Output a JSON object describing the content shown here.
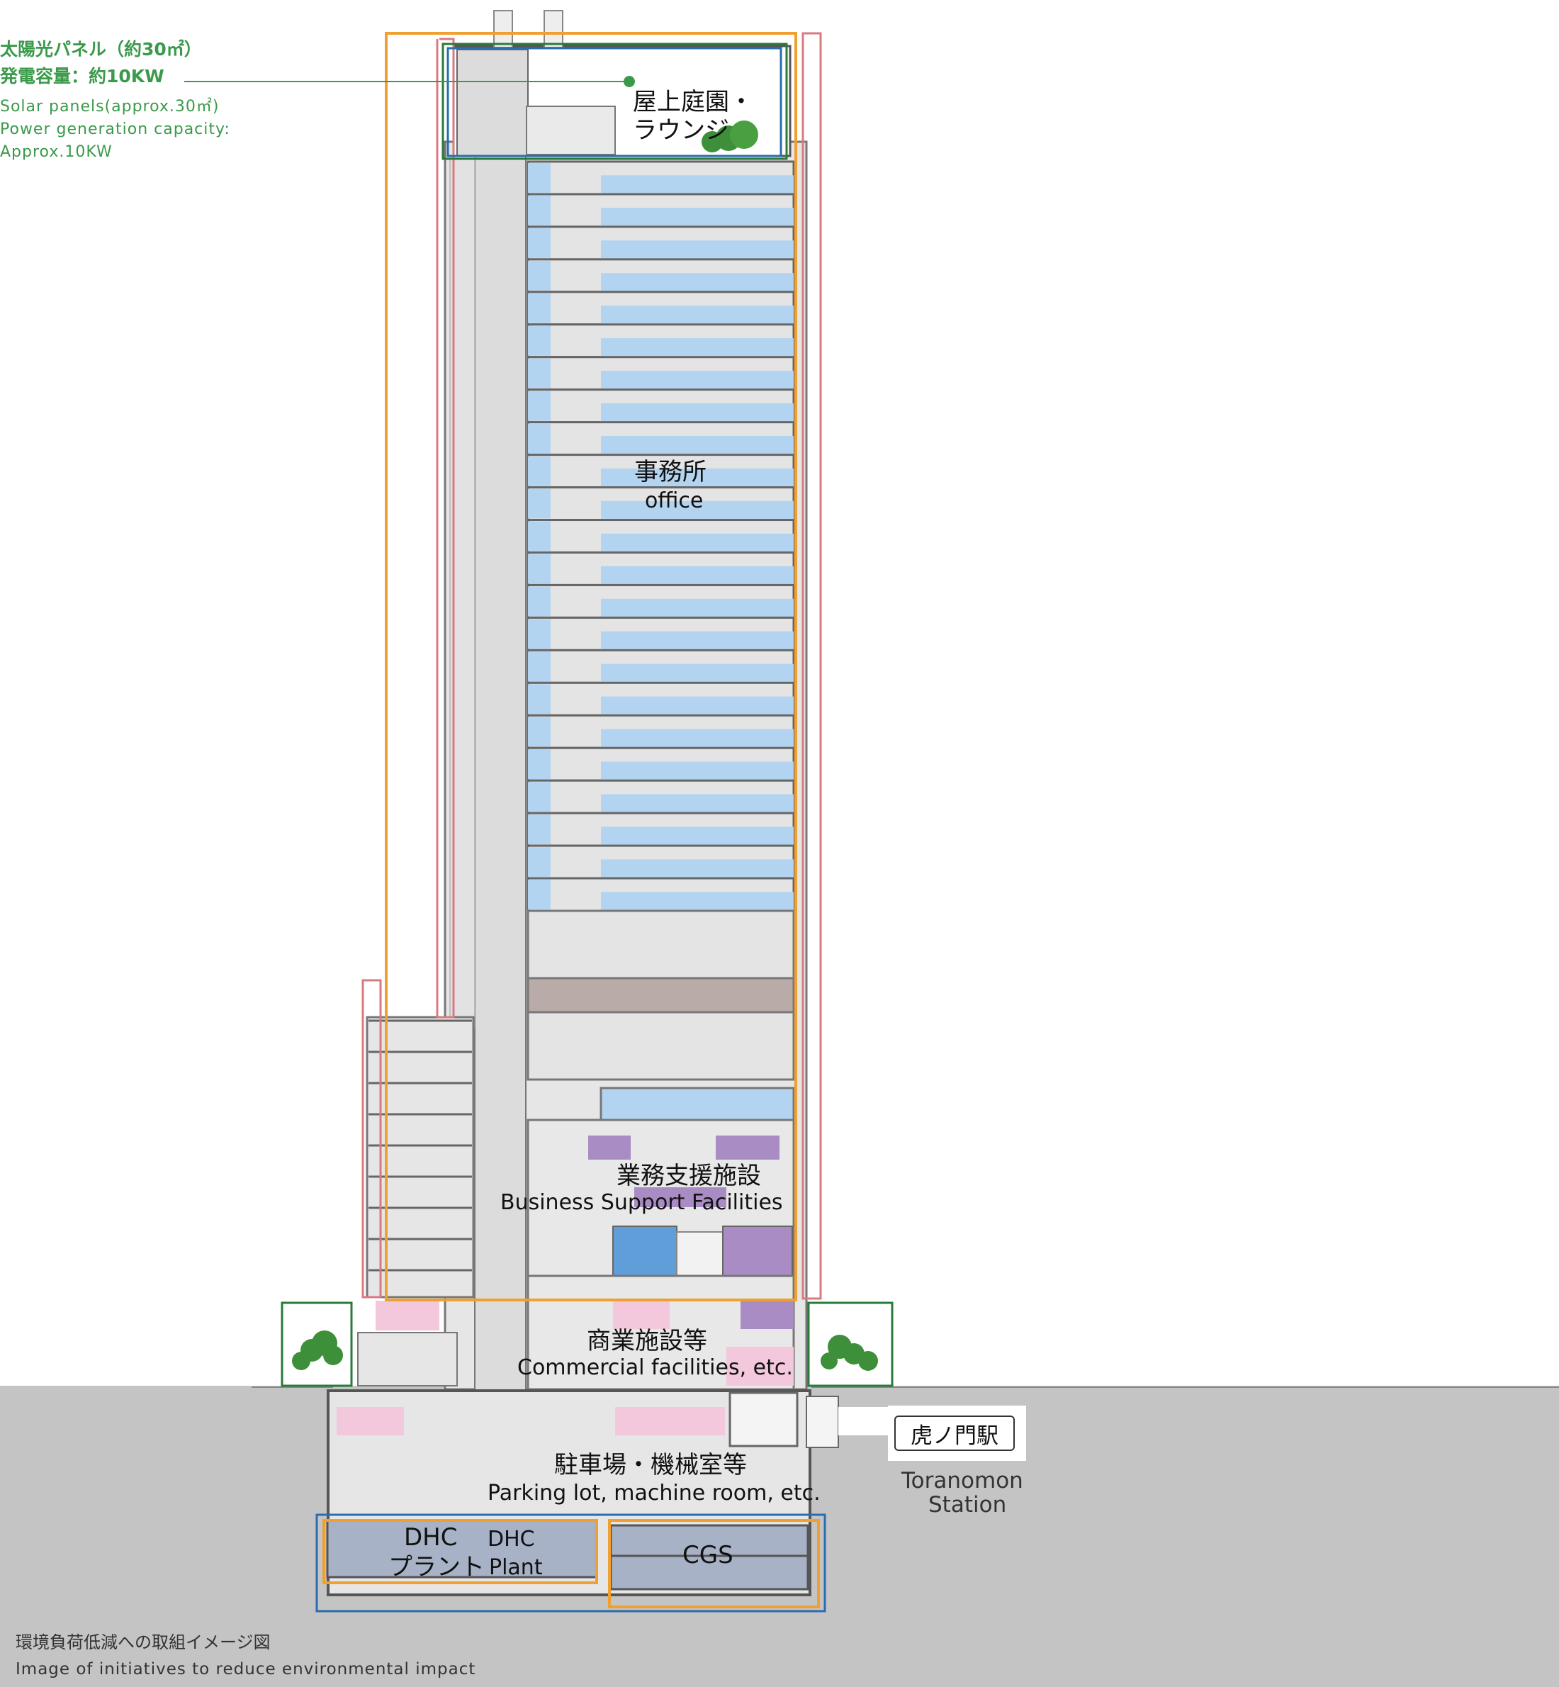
{
  "solar": {
    "ja_line1": "太陽光パネル（約30㎡）",
    "ja_line2": "発電容量：約10KW",
    "en_line1": "Solar panels(approx.30㎡)",
    "en_line2": "Power generation capacity:",
    "en_line3": "Approx.10KW"
  },
  "rooftop": {
    "ja_line1": "屋上庭園・",
    "ja_line2": "ラウンジ"
  },
  "office": {
    "ja": "事務所",
    "en": "office"
  },
  "business_support": {
    "ja": "業務支援施設",
    "en": "Business Support Facilities"
  },
  "commercial": {
    "ja": "商業施設等",
    "en": "Commercial facilities, etc."
  },
  "parking": {
    "ja": "駐車場・機械室等",
    "en": "Parking lot, machine room, etc."
  },
  "dhc": {
    "ja_line1": "DHC",
    "ja_line2": "プラント",
    "en_line1": "DHC",
    "en_line2": "Plant"
  },
  "cgs": {
    "label": "CGS"
  },
  "station": {
    "sign": "虎ノ門駅",
    "en_line1": "Toranomon",
    "en_line2": "Station"
  },
  "caption": {
    "ja": "環境負荷低減への取組イメージ図",
    "en": "Image of initiatives to reduce environmental impact"
  },
  "colors": {
    "office_blue": "#b3d4f0",
    "commercial_pink": "#f4c8dc",
    "support_purple": "#a98cc3",
    "mechanical_brown": "#b8aba8",
    "ground_gray": "#c4c4c4",
    "structure_gray": "#e6e6e6",
    "outline_orange": "#f0a030",
    "outline_red": "#d87a80",
    "outline_green": "#2a7a3a",
    "outline_blue": "#2a6cb0",
    "accent_green": "#3a9a4a"
  }
}
